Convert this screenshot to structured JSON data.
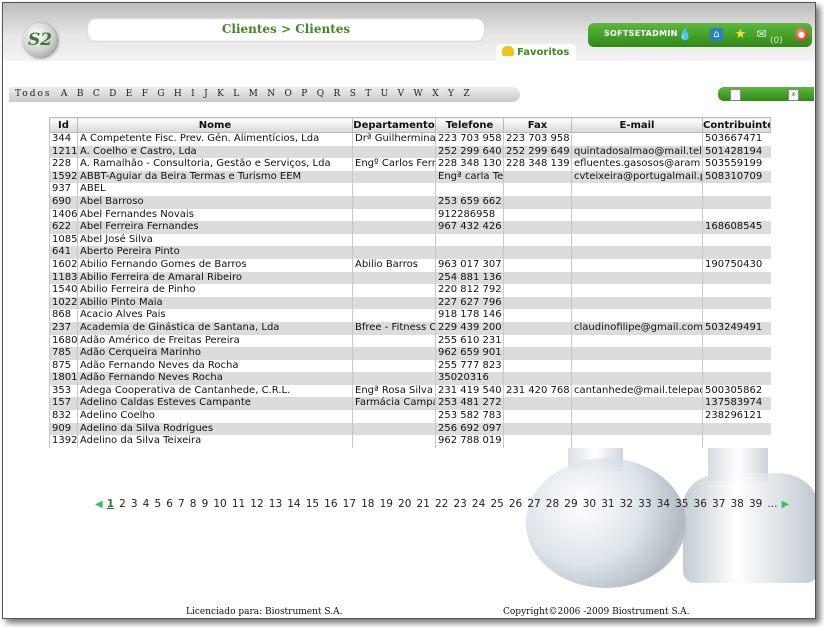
{
  "logo_text": "S2",
  "breadcrumb": "Clientes > Clientes",
  "user": {
    "name": "SOFTSETADMIN",
    "messages_count": "(0)"
  },
  "favorites_tab": "Favoritos",
  "alphabet": [
    "Todos",
    "A",
    "B",
    "C",
    "D",
    "E",
    "F",
    "G",
    "H",
    "I",
    "J",
    "K",
    "L",
    "M",
    "N",
    "O",
    "P",
    "Q",
    "R",
    "S",
    "T",
    "U",
    "V",
    "W",
    "X",
    "Y",
    "Z"
  ],
  "table": {
    "columns": [
      "Id",
      "Nome",
      "Departamento",
      "Telefone",
      "Fax",
      "E-mail",
      "Contribuinte"
    ],
    "rows": [
      [
        "344",
        "A Competente Fisc. Prev. Gén. Alimentícios, Lda",
        "Drª Guilhermina",
        "223 703 958",
        "223 703 958",
        "",
        "503667471"
      ],
      [
        "1211",
        "A. Coelho e Castro, Lda",
        "",
        "252 299 640",
        "252 299 649",
        "quintadosalmao@mail.tele",
        "501428194"
      ],
      [
        "228",
        "A. Ramalhão - Consultoria, Gestão e Serviços, Lda",
        "Engº Carlos Fern",
        "228 348 130",
        "228 348 139",
        "efluentes.gasosos@aram",
        "503559199"
      ],
      [
        "1592",
        "ABBT-Aguiar da Beira Termas e Turismo EEM",
        "",
        "Engª carla Te",
        "",
        "cvteixeira@portugalmail.p",
        "508310709"
      ],
      [
        "937",
        "ABEL",
        "",
        "",
        "",
        "",
        ""
      ],
      [
        "690",
        "Abel Barroso",
        "",
        "253 659 662",
        "",
        "",
        ""
      ],
      [
        "1406",
        "Abel Fernandes Novais",
        "",
        "912286958",
        "",
        "",
        ""
      ],
      [
        "622",
        "Abel Ferreira Fernandes",
        "",
        "967 432 426",
        "",
        "",
        "168608545"
      ],
      [
        "1085",
        "Abel José Silva",
        "",
        "",
        "",
        "",
        ""
      ],
      [
        "641",
        "Aberto Pereira Pinto",
        "",
        "",
        "",
        "",
        ""
      ],
      [
        "1602",
        "Abilio Fernando Gomes de Barros",
        "Abilio Barros",
        "963 017 307",
        "",
        "",
        "190750430"
      ],
      [
        "1183",
        "Abilio Ferreira de Amaral Ribeiro",
        "",
        "254 881 136",
        "",
        "",
        ""
      ],
      [
        "1540",
        "Abilio Ferreira de Pinho",
        "",
        "220 812 792",
        "",
        "",
        ""
      ],
      [
        "1022",
        "Abilio Pinto Maia",
        "",
        "227 627 796",
        "",
        "",
        ""
      ],
      [
        "868",
        "Acacio Alves Pais",
        "",
        "918 178 146",
        "",
        "",
        ""
      ],
      [
        "237",
        "Academia de Ginástica de Santana, Lda",
        "Bfree - Fitness C",
        "229 439 200",
        "",
        "claudinofilipe@gmail.com",
        "503249491"
      ],
      [
        "1680",
        "Adão Américo de Freitas Pereira",
        "",
        "255 610 231",
        "",
        "",
        ""
      ],
      [
        "785",
        "Adão Cerqueira Marinho",
        "",
        "962 659 901",
        "",
        "",
        ""
      ],
      [
        "875",
        "Adão Fernando Neves da Rocha",
        "",
        "255 777 823",
        "",
        "",
        ""
      ],
      [
        "1801",
        "Adão Fernando Neves Rocha",
        "",
        "35020316",
        "",
        "",
        ""
      ],
      [
        "353",
        "Adega Cooperativa de Cantanhede, C.R.L.",
        "Engª Rosa Silva",
        "231 419 540",
        "231 420 768",
        "cantanhede@mail.telepac",
        "500305862"
      ],
      [
        "157",
        "Adelino Caldas Esteves Campante",
        "Farmácia Campa",
        "253 481 272",
        "",
        "",
        "137583974"
      ],
      [
        "832",
        "Adelino Coelho",
        "",
        "253 582 783",
        "",
        "",
        "238296121"
      ],
      [
        "909",
        "Adelino da Silva Rodrigues",
        "",
        "256 692 097",
        "",
        "",
        ""
      ],
      [
        "1392",
        "Adelino da Silva Teixeira",
        "",
        "962 788 019",
        "",
        "",
        ""
      ]
    ]
  },
  "pagination": {
    "current": "1",
    "pages": [
      "1",
      "2",
      "3",
      "4",
      "5",
      "6",
      "7",
      "8",
      "9",
      "10",
      "11",
      "12",
      "13",
      "14",
      "15",
      "16",
      "17",
      "18",
      "19",
      "20",
      "21",
      "22",
      "23",
      "24",
      "25",
      "26",
      "27",
      "28",
      "29",
      "30",
      "31",
      "32",
      "33",
      "34",
      "35",
      "36",
      "37",
      "38",
      "39"
    ],
    "ellipsis": "..."
  },
  "footer": {
    "license": "Licenciado para: Biostrument S.A.",
    "copyright": "Copyright©2006 -2009 Biostrument S.A."
  }
}
